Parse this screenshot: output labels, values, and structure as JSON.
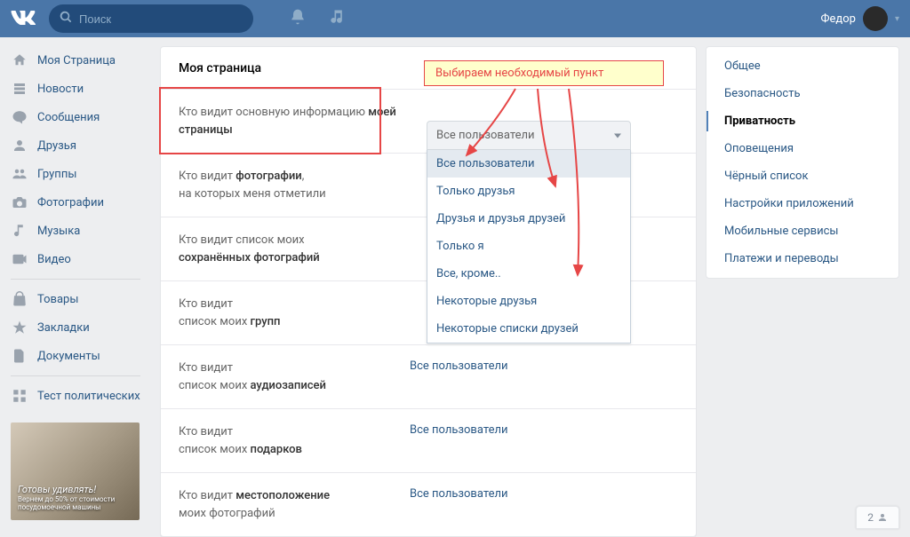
{
  "header": {
    "search_placeholder": "Поиск",
    "user_name": "Федор"
  },
  "left_nav": {
    "items": [
      {
        "label": "Моя Страница"
      },
      {
        "label": "Новости"
      },
      {
        "label": "Сообщения"
      },
      {
        "label": "Друзья"
      },
      {
        "label": "Группы"
      },
      {
        "label": "Фотографии"
      },
      {
        "label": "Музыка"
      },
      {
        "label": "Видео"
      }
    ],
    "items2": [
      {
        "label": "Товары"
      },
      {
        "label": "Закладки"
      },
      {
        "label": "Документы"
      }
    ],
    "items3": [
      {
        "label": "Тест политических"
      }
    ],
    "ad_title": "Готовы удивлять!",
    "ad_sub": "Вернем до 50% от стоимости\nпосудомоечной машины"
  },
  "main": {
    "title": "Моя страница",
    "settings": [
      {
        "label_a": "Кто видит основную информацию ",
        "label_b": "моей страницы",
        "value": ""
      },
      {
        "label_a": "Кто видит ",
        "label_b": "фотографии",
        "label_c": ",\nна которых меня отметили",
        "value": ""
      },
      {
        "label_a": "Кто видит список моих\n",
        "label_b": "сохранённых фотографий",
        "value": ""
      },
      {
        "label_a": "Кто видит\nсписок моих ",
        "label_b": "групп",
        "value": ""
      },
      {
        "label_a": "Кто видит\nсписок моих ",
        "label_b": "аудиозаписей",
        "value": "Все пользователи"
      },
      {
        "label_a": "Кто видит\nсписок моих ",
        "label_b": "подарков",
        "value": "Все пользователи"
      },
      {
        "label_a": "Кто видит ",
        "label_b": "местоположение",
        "label_c": "\nмоих фотографий",
        "value": "Все пользователи"
      }
    ]
  },
  "dropdown": {
    "selected": "Все пользователи",
    "options": [
      "Все пользователи",
      "Только друзья",
      "Друзья и друзья друзей",
      "Только я",
      "Все, кроме..",
      "Некоторые друзья",
      "Некоторые списки друзей"
    ]
  },
  "right_nav": {
    "items": [
      {
        "label": "Общее"
      },
      {
        "label": "Безопасность"
      },
      {
        "label": "Приватность",
        "active": true
      },
      {
        "label": "Оповещения"
      },
      {
        "label": "Чёрный список"
      },
      {
        "label": "Настройки приложений"
      },
      {
        "label": "Мобильные сервисы"
      },
      {
        "label": "Платежи и переводы"
      }
    ]
  },
  "annotation": "Выбираем необходимый пункт",
  "friends_widget": "2"
}
